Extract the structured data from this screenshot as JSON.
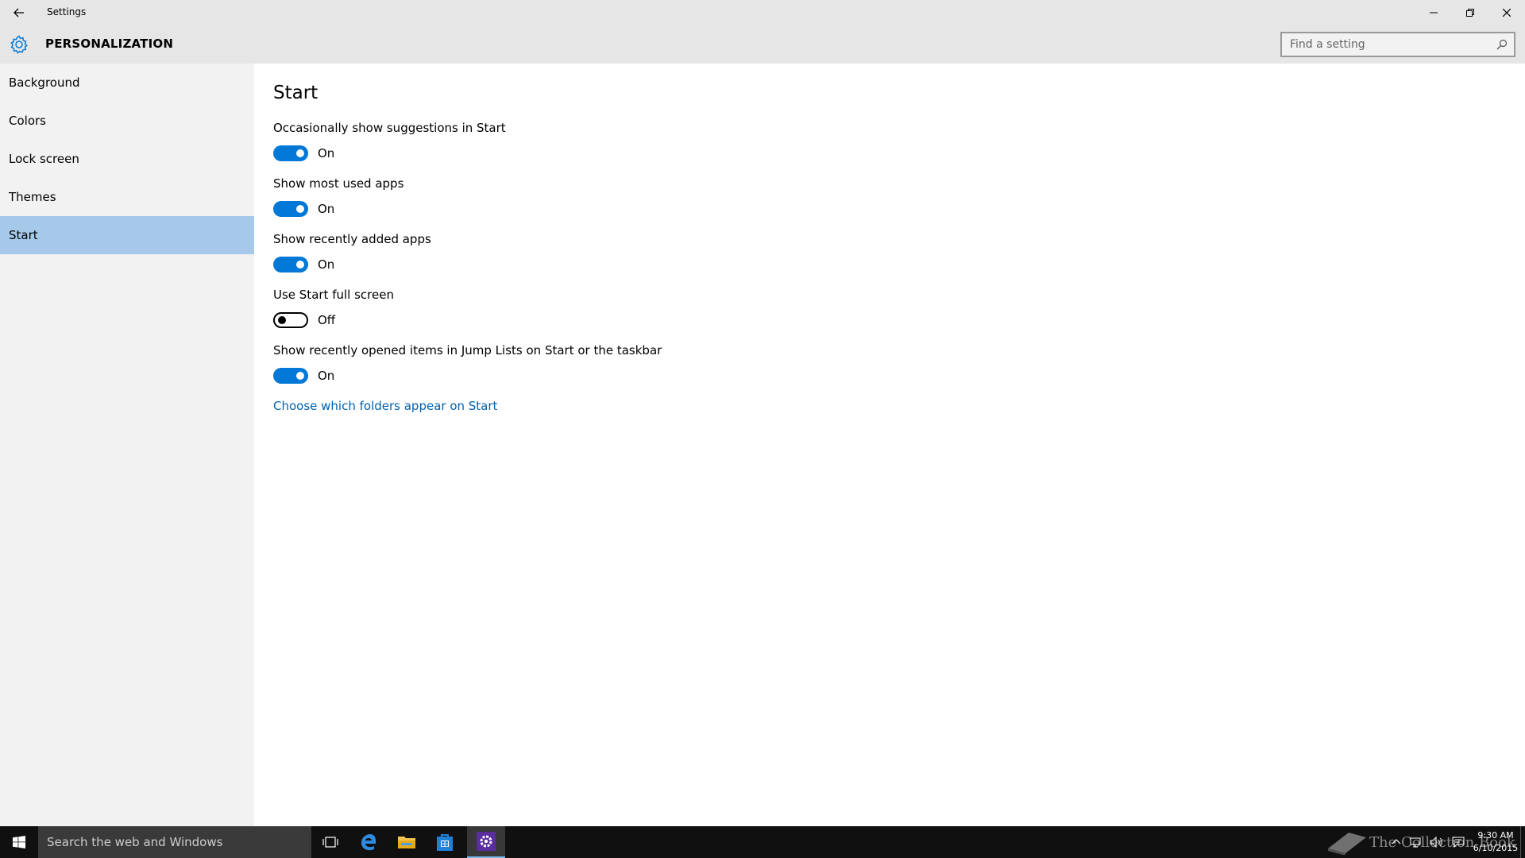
{
  "window": {
    "title": "Settings"
  },
  "header": {
    "section_title": "PERSONALIZATION",
    "search_placeholder": "Find a setting"
  },
  "sidebar": {
    "items": [
      {
        "label": "Background",
        "active": false
      },
      {
        "label": "Colors",
        "active": false
      },
      {
        "label": "Lock screen",
        "active": false
      },
      {
        "label": "Themes",
        "active": false
      },
      {
        "label": "Start",
        "active": true
      }
    ]
  },
  "content": {
    "page_title": "Start",
    "settings": [
      {
        "label": "Occasionally show suggestions in Start",
        "state": "On",
        "on": true
      },
      {
        "label": "Show most used apps",
        "state": "On",
        "on": true
      },
      {
        "label": "Show recently added apps",
        "state": "On",
        "on": true
      },
      {
        "label": "Use Start full screen",
        "state": "Off",
        "on": false
      },
      {
        "label": "Show recently opened items in Jump Lists on Start or the taskbar",
        "state": "On",
        "on": true
      }
    ],
    "link": "Choose which folders appear on Start"
  },
  "taskbar": {
    "search_text": "Search the web and Windows",
    "icons": [
      "task-view-icon",
      "edge-icon",
      "file-explorer-icon",
      "store-icon",
      "settings-icon"
    ],
    "watermark": "The Collection Book",
    "time": "9:30 AM",
    "date": "6/10/2015"
  },
  "colors": {
    "accent": "#0078d7",
    "sidebar_selected": "#a6c9ea",
    "link": "#0063b1"
  }
}
